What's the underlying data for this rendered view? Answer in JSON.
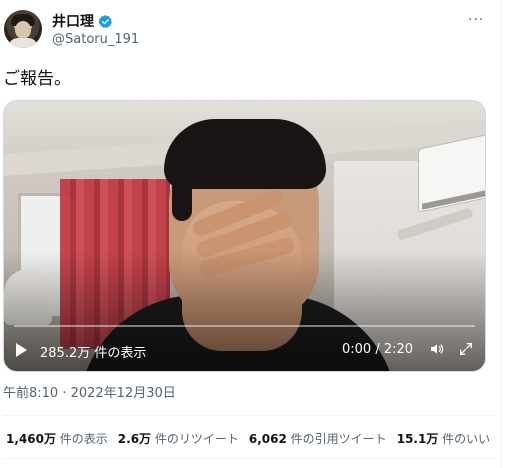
{
  "author": {
    "display_name": "井口理",
    "handle": "@Satoru_191",
    "verified": true
  },
  "tweet": {
    "text": "ご報告。",
    "timestamp": "午前8:10 · 2022年12月30日"
  },
  "video": {
    "views_overlay": "285.2万 件の表示",
    "time": "0:00 / 2:20",
    "progress": 0
  },
  "stats": [
    {
      "num": "1,460万",
      "label": " 件の表示"
    },
    {
      "num": "2.6万",
      "label": " 件のリツイート"
    },
    {
      "num": "6,062",
      "label": " 件の引用ツイート"
    },
    {
      "num": "15.1万",
      "label": " 件のいい"
    }
  ],
  "icons": {
    "more": "more-icon",
    "verified": "verified-badge-icon",
    "play": "play-icon",
    "volume": "volume-icon",
    "fullscreen": "fullscreen-icon"
  },
  "colors": {
    "text_primary": "#0f1419",
    "text_secondary": "#536471",
    "verified_blue": "#1d9bf0"
  }
}
